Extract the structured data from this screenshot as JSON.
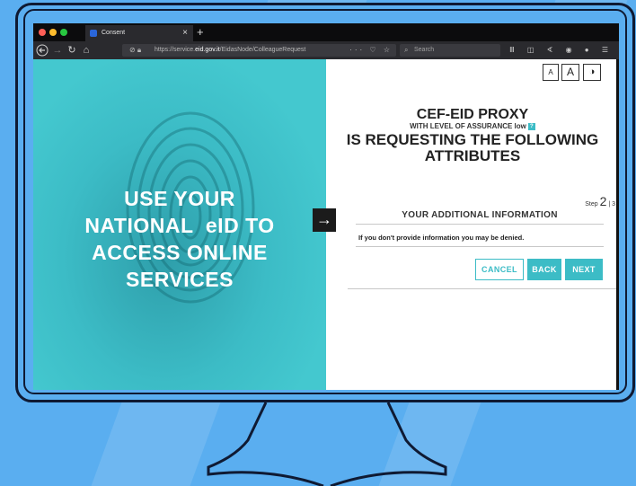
{
  "browser": {
    "tab_title": "Consent",
    "tab_close": "×",
    "new_tab": "+",
    "url_prefix": "https://service.",
    "url_domain": "eid.gov.it",
    "url_path": "/EidasNode/ColleagueRequest",
    "url_actions": "··· ♡ ☆",
    "search_placeholder": "Search"
  },
  "left_panel": {
    "headline_line1": "USE YOUR",
    "headline_line2": "NATIONAL  eID TO",
    "headline_line3": "ACCESS ONLINE",
    "headline_line4": "SERVICES",
    "arrow": "→"
  },
  "right_panel": {
    "font_small": "A",
    "font_large": "A",
    "contrast": "◑",
    "title_proxy": "CEF-EID PROXY",
    "title_loa_text": "WITH LEVEL OF ASSURANCE low",
    "title_loa_badge": "?",
    "title_requesting_line1": "IS REQUESTING THE FOLLOWING",
    "title_requesting_line2": "ATTRIBUTES",
    "step_label": "Step",
    "step_current": "2",
    "step_sep": "|",
    "step_total": "3",
    "section_title": "YOUR ADDITIONAL INFORMATION",
    "notice": "If you don't provide information you may be denied.",
    "cancel_label": "CANCEL",
    "back_label": "BACK",
    "next_label": "NEXT"
  },
  "colors": {
    "accent": "#3cbcc6",
    "background": "#5aaef0",
    "monitor_outline": "#0f1a33"
  }
}
